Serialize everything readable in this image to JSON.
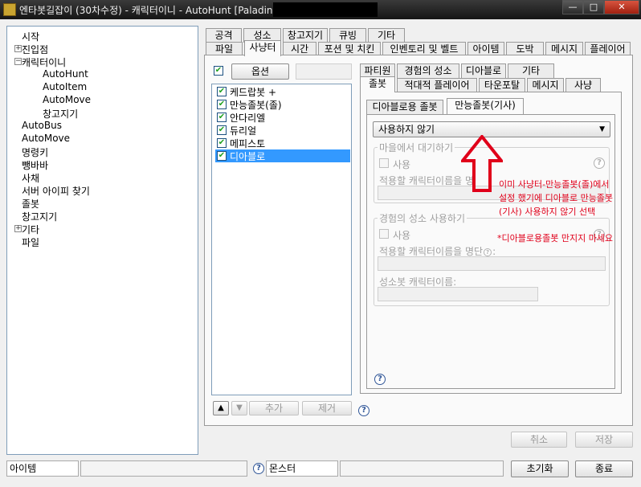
{
  "window": {
    "title": "엔타봇길잡이 (30차수정) - 캐릭터이니 - AutoHunt [Paladin",
    "min_glyph": "—",
    "max_glyph": "□",
    "close_glyph": "✕"
  },
  "tree": {
    "items": [
      {
        "label": "시작"
      },
      {
        "label": "진입점",
        "expander": "+"
      },
      {
        "label": "캐릭터이니",
        "expander": "−"
      },
      {
        "label": "AutoHunt"
      },
      {
        "label": "AutoItem"
      },
      {
        "label": "AutoMove"
      },
      {
        "label": "창고지기"
      },
      {
        "label": "AutoBus"
      },
      {
        "label": "AutoMove"
      },
      {
        "label": "명령키"
      },
      {
        "label": "뺑바바"
      },
      {
        "label": "사채"
      },
      {
        "label": "서버 아이피 찾기"
      },
      {
        "label": "졸봇"
      },
      {
        "label": "창고지기"
      },
      {
        "label": "기타",
        "expander": "+"
      },
      {
        "label": "파일"
      }
    ]
  },
  "top_tabs_row1": [
    "공격",
    "성소",
    "창고지기",
    "큐빙",
    "기타"
  ],
  "top_tabs_row2": [
    "파일",
    "사냥터",
    "시간",
    "포션 및 치킨",
    "인벤토리 및 벨트",
    "아이템",
    "도박",
    "메시지",
    "플레이어"
  ],
  "left_panel": {
    "option_button": "옵션",
    "list": [
      {
        "label": "케드랍봇 +",
        "checked": true
      },
      {
        "label": "만능졸봇(졸)",
        "checked": true
      },
      {
        "label": "안다리엘",
        "checked": true
      },
      {
        "label": "듀리얼",
        "checked": true
      },
      {
        "label": "메피스토",
        "checked": true
      },
      {
        "label": "디아블로",
        "checked": true,
        "selected": true
      }
    ],
    "up_glyph": "▲",
    "down_glyph": "▼",
    "add_button": "추가",
    "remove_button": "제거"
  },
  "right_tabs_row1": [
    "파티원",
    "경험의 성소",
    "디아블로",
    "기타"
  ],
  "right_tabs_row2": [
    "졸봇",
    "적대적 플레이어",
    "타운포탈",
    "메시지",
    "사냥"
  ],
  "sub_tabs": [
    "디아블로용 졸봇",
    "만능졸봇(기사)"
  ],
  "dropdown": {
    "value": "사용하지 않기",
    "arrow": "▼"
  },
  "group1": {
    "title": "마을에서 대기하기",
    "use_label": "사용",
    "apply_label": "적용할 캐릭터이름을 명",
    "help": "?"
  },
  "group2": {
    "title": "경험의 성소 사용하기",
    "use_label": "사용",
    "apply_label": "적용할 캐릭터이름을 명단",
    "apply_help": "?",
    "apply_suffix": ":",
    "bot_label": "성소봇 캐릭터이름:",
    "help": "?"
  },
  "bottom_help": "?",
  "annotation": {
    "line1": "이미 사냥터-만능졸봇(졸)에서",
    "line2": "설정 했기에 디아블로 만능졸봇",
    "line3": "(기사) 사용하지 않기 선택",
    "line4": "*디아블로용졸봇 만지지 마세요",
    "arrow_color": "#e0001a"
  },
  "footer": {
    "cancel": "취소",
    "save": "저장",
    "item_label": "아이템",
    "help": "?",
    "monster_label": "몬스터",
    "reset": "초기화",
    "exit": "종료"
  }
}
